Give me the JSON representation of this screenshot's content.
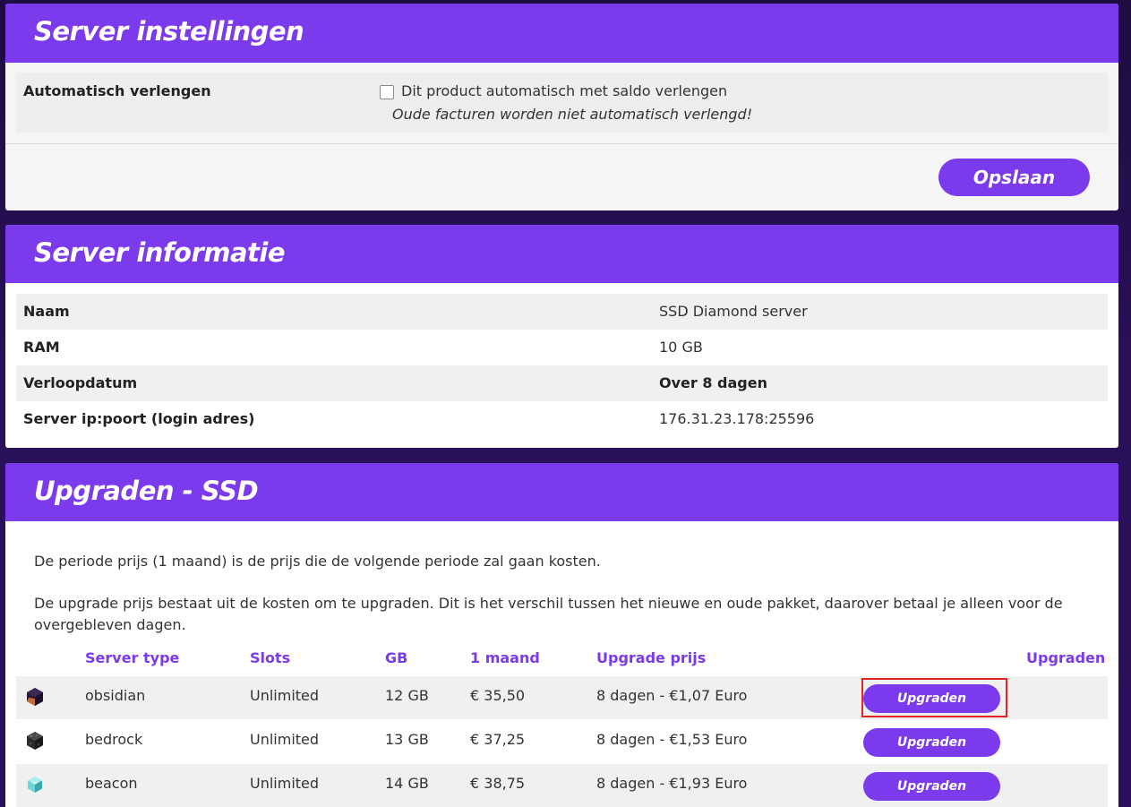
{
  "settings": {
    "title": "Server instellingen",
    "auto_renew_label": "Automatisch verlengen",
    "checkbox_label": "Dit product automatisch met saldo verlengen",
    "note": "Oude facturen worden niet automatisch verlengd!",
    "save_label": "Opslaan"
  },
  "info": {
    "title": "Server informatie",
    "rows": [
      {
        "label": "Naam",
        "value": "SSD Diamond server"
      },
      {
        "label": "RAM",
        "value": "10 GB"
      },
      {
        "label": "Verloopdatum",
        "value": "Over 8 dagen"
      },
      {
        "label": "Server ip:poort (login adres)",
        "value": "176.31.23.178:25596"
      }
    ]
  },
  "upgrade": {
    "title": "Upgraden - SSD",
    "para1": "De periode prijs (1 maand) is de prijs die de volgende periode zal gaan kosten.",
    "para2": "De upgrade prijs bestaat uit de kosten om te upgraden. Dit is het verschil tussen het nieuwe en oude pakket, daarover betaal je alleen voor de overgebleven dagen.",
    "headers": [
      "Server type",
      "Slots",
      "GB",
      "1 maand",
      "Upgrade prijs",
      "Upgraden"
    ],
    "rows": [
      {
        "icon": "obsidian-icon",
        "type": "obsidian",
        "slots": "Unlimited",
        "gb": "12 GB",
        "month": "€ 35,50",
        "upgrade": "8 dagen - €1,07 Euro",
        "button": "Upgraden"
      },
      {
        "icon": "bedrock-icon",
        "type": "bedrock",
        "slots": "Unlimited",
        "gb": "13 GB",
        "month": "€ 37,25",
        "upgrade": "8 dagen - €1,53 Euro",
        "button": "Upgraden"
      },
      {
        "icon": "beacon-icon",
        "type": "beacon",
        "slots": "Unlimited",
        "gb": "14 GB",
        "month": "€ 38,75",
        "upgrade": "8 dagen - €1,93 Euro",
        "button": "Upgraden"
      }
    ]
  },
  "colors": {
    "accent": "#7c3aed",
    "highlight": "#e02424"
  }
}
